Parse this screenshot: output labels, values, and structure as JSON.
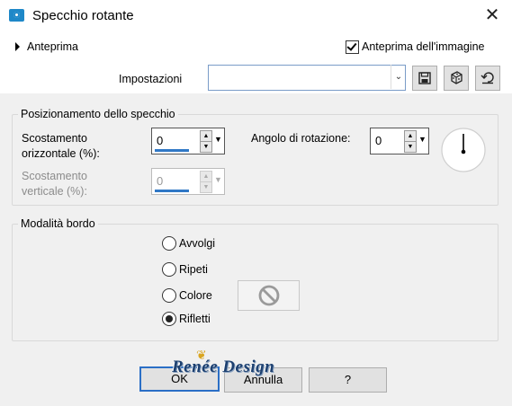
{
  "window": {
    "title": "Specchio rotante",
    "close_glyph": "✕"
  },
  "preview": {
    "toggle_label": "Anteprima",
    "image_preview_label": "Anteprima dell'immagine",
    "image_preview_checked": true
  },
  "settings": {
    "label": "Impostazioni",
    "value": "",
    "icons": [
      "save-icon",
      "dice-icon",
      "reset-icon"
    ]
  },
  "mirror_position": {
    "legend": "Posizionamento dello specchio",
    "horizontal_label": "Scostamento orizzontale (%):",
    "horizontal_value": "0",
    "vertical_label": "Scostamento verticale (%):",
    "vertical_value": "0",
    "vertical_enabled": false,
    "rotation_label": "Angolo di rotazione:",
    "rotation_value": "0"
  },
  "edge_mode": {
    "legend": "Modalità bordo",
    "options": [
      "Avvolgi",
      "Ripeti",
      "Colore",
      "Rifletti"
    ],
    "selected": "Rifletti"
  },
  "buttons": {
    "ok": "OK",
    "cancel": "Annulla",
    "help": "?"
  },
  "watermark": "Renée Design",
  "colors": {
    "accent": "#3078c6",
    "background": "#f0f0f0",
    "button_face": "#e1e1e1"
  }
}
